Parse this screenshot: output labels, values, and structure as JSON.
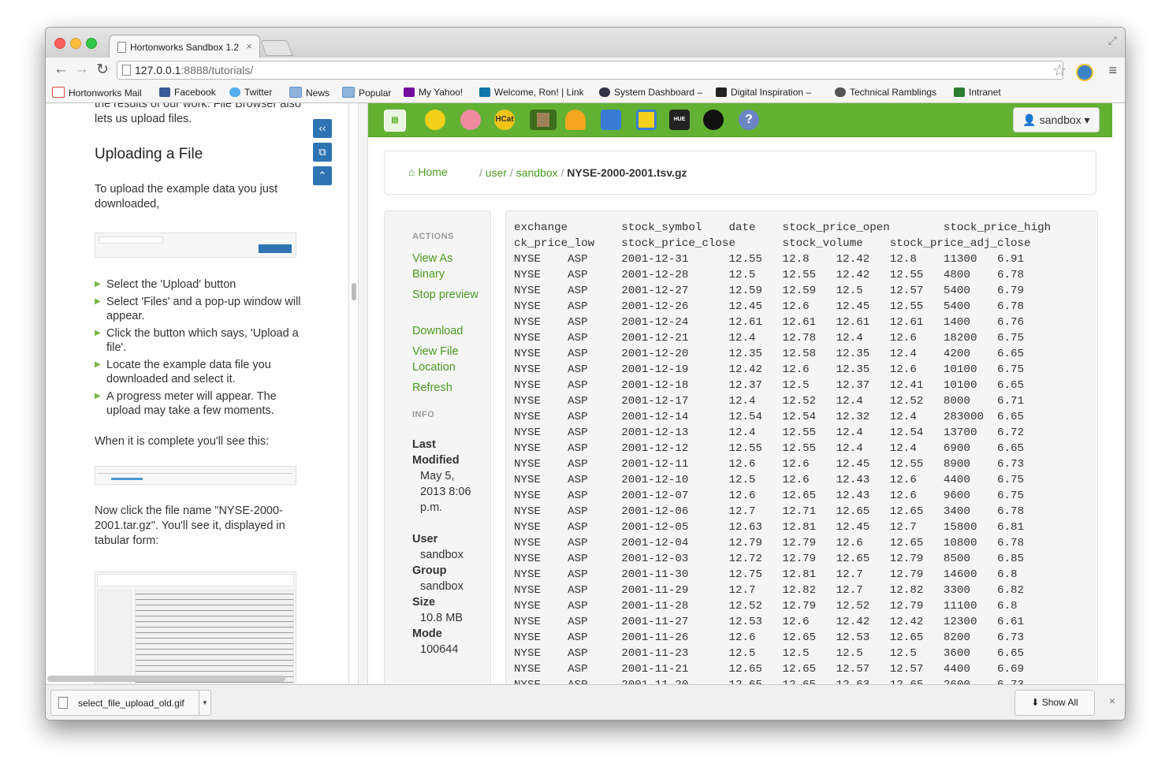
{
  "browser": {
    "tab_title": "Hortonworks Sandbox 1.2",
    "tab_close": "×",
    "url_host": "127.0.0.1",
    "url_path": ":8888/tutorials/",
    "back": "←",
    "forward": "→",
    "reload": "↻",
    "star": "☆",
    "menu": "≡",
    "fullscreen": "⤢",
    "bookmarks": [
      "Hortonworks Mail",
      "Facebook",
      "Twitter",
      "News",
      "Popular",
      "My Yahoo!",
      "Welcome, Ron! | Link",
      "System Dashboard –",
      "Digital Inspiration –",
      "Technical Ramblings",
      "Intranet"
    ]
  },
  "tutorial": {
    "intro_text": "the results of our work. File Browser also lets us upload files.",
    "heading": "Uploading a File",
    "para1": "To upload the example data you just downloaded,",
    "bullets": [
      "Select the 'Upload' button",
      "Select 'Files' and a pop-up window will appear.",
      "Click the button which says, 'Upload a file'.",
      "Locate the example data file you downloaded and select it.",
      "A progress meter will appear. The upload may take a few moments."
    ],
    "para2": "When it is complete you'll see this:",
    "para3": "Now click the file name \"NYSE-2000-2001.tar.gz\". You'll see it, displayed in tabular form:",
    "side_buttons": [
      "‹‹",
      "⧉",
      "⌃"
    ]
  },
  "hue": {
    "app_icons": [
      "file-browser",
      "beeswax",
      "pig",
      "hcat",
      "job-browser",
      "oozie",
      "job-designer",
      "table",
      "shell",
      "user",
      "help"
    ],
    "user_button": "sandbox",
    "breadcrumb": {
      "home": "Home",
      "user": "user",
      "sandbox": "sandbox",
      "sep": "/",
      "file": "NYSE-2000-2001.tsv.gz"
    },
    "actions_header": "ACTIONS",
    "actions": [
      "View As Binary",
      "Stop preview",
      "Download",
      "View File Location",
      "Refresh"
    ],
    "info_header": "INFO",
    "info": {
      "last_modified_label": "Last Modified",
      "last_modified_value": "May 5, 2013 8:06 p.m.",
      "user_label": "User",
      "user_value": "sandbox",
      "group_label": "Group",
      "group_value": "sandbox",
      "size_label": "Size",
      "size_value": "10.8 MB",
      "mode_label": "Mode",
      "mode_value": "100644"
    },
    "file_content": "exchange        stock_symbol    date    stock_price_open        stock_price_high        sto\nck_price_low    stock_price_close       stock_volume    stock_price_adj_close\nNYSE    ASP     2001-12-31      12.55   12.8    12.42   12.8    11300   6.91\nNYSE    ASP     2001-12-28      12.5    12.55   12.42   12.55   4800    6.78\nNYSE    ASP     2001-12-27      12.59   12.59   12.5    12.57   5400    6.79\nNYSE    ASP     2001-12-26      12.45   12.6    12.45   12.55   5400    6.78\nNYSE    ASP     2001-12-24      12.61   12.61   12.61   12.61   1400    6.76\nNYSE    ASP     2001-12-21      12.4    12.78   12.4    12.6    18200   6.75\nNYSE    ASP     2001-12-20      12.35   12.58   12.35   12.4    4200    6.65\nNYSE    ASP     2001-12-19      12.42   12.6    12.35   12.6    10100   6.75\nNYSE    ASP     2001-12-18      12.37   12.5    12.37   12.41   10100   6.65\nNYSE    ASP     2001-12-17      12.4    12.52   12.4    12.52   8000    6.71\nNYSE    ASP     2001-12-14      12.54   12.54   12.32   12.4    283000  6.65\nNYSE    ASP     2001-12-13      12.4    12.55   12.4    12.54   13700   6.72\nNYSE    ASP     2001-12-12      12.55   12.55   12.4    12.4    6900    6.65\nNYSE    ASP     2001-12-11      12.6    12.6    12.45   12.55   8900    6.73\nNYSE    ASP     2001-12-10      12.5    12.6    12.43   12.6    4400    6.75\nNYSE    ASP     2001-12-07      12.6    12.65   12.43   12.6    9600    6.75\nNYSE    ASP     2001-12-06      12.7    12.71   12.65   12.65   3400    6.78\nNYSE    ASP     2001-12-05      12.63   12.81   12.45   12.7    15800   6.81\nNYSE    ASP     2001-12-04      12.79   12.79   12.6    12.65   10800   6.78\nNYSE    ASP     2001-12-03      12.72   12.79   12.65   12.79   8500    6.85\nNYSE    ASP     2001-11-30      12.75   12.81   12.7    12.79   14600   6.8\nNYSE    ASP     2001-11-29      12.7    12.82   12.7    12.82   3300    6.82\nNYSE    ASP     2001-11-28      12.52   12.79   12.52   12.79   11100   6.8\nNYSE    ASP     2001-11-27      12.53   12.6    12.42   12.42   12300   6.61\nNYSE    ASP     2001-11-26      12.6    12.65   12.53   12.65   8200    6.73\nNYSE    ASP     2001-11-23      12.5    12.5    12.5    12.5    3600    6.65\nNYSE    ASP     2001-11-21      12.65   12.65   12.57   12.57   4400    6.69\nNYSE    ASP     2001-11-20      12.65   12.65   12.63   12.65   2600    6.73"
  },
  "downloads": {
    "file_name": "select_file_upload_old.gif",
    "show_all": "Show All",
    "close": "×"
  }
}
